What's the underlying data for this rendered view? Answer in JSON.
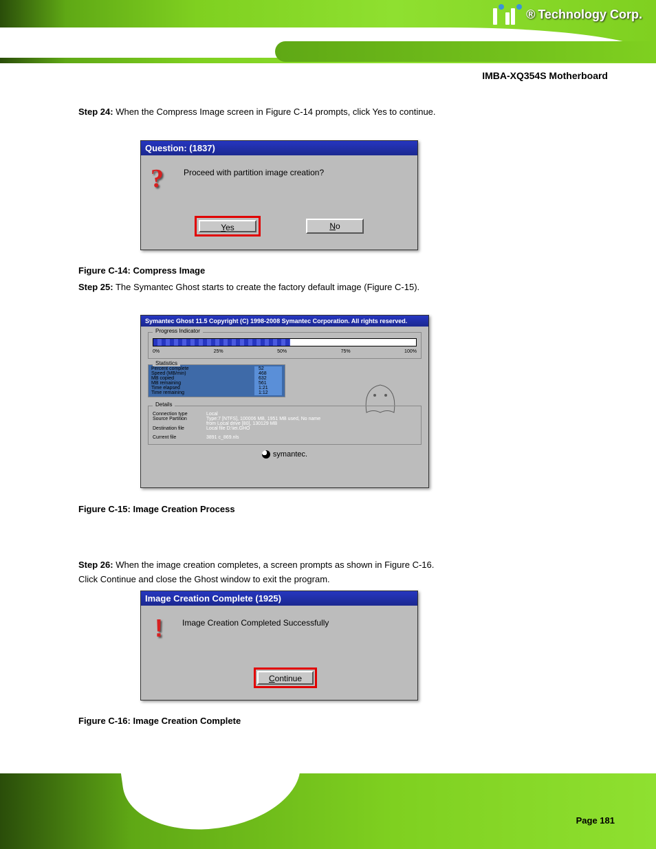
{
  "header": {
    "brand_prefix": "®",
    "brand": "Technology Corp."
  },
  "model_line": "IMBA-XQ354S Motherboard",
  "step24": {
    "num": "Step 24:",
    "text": " When the Compress Image screen in Figure C-14 prompts, click Yes to continue."
  },
  "caption14": "Figure C-14: Compress Image",
  "step25": {
    "num": "Step 25:",
    "text": " The Symantec Ghost starts to create the factory default image (Figure C-15)."
  },
  "caption15": "Figure C-15: Image Creation Process",
  "step26": {
    "num": "Step 26:",
    "text_a": " When the image creation completes, a screen prompts as shown in Figure C-16.",
    "text_b": "Click Continue and close the Ghost window to exit the program."
  },
  "caption16": "Figure C-16: Image Creation Complete",
  "page": "Page 181",
  "dlg1": {
    "title": "Question: (1837)",
    "message": "Proceed with partition image creation?",
    "yes": "Yes",
    "no": "No"
  },
  "ghost": {
    "title": "Symantec Ghost 11.5   Copyright (C) 1998-2008 Symantec Corporation. All rights reserved.",
    "progress_legend": "Progress Indicator",
    "ticks": [
      "0%",
      "25%",
      "50%",
      "75%",
      "100%"
    ],
    "stats_legend": "Statistics",
    "stats": {
      "percent_complete_lbl": "Percent complete",
      "percent_complete": "52",
      "speed_lbl": "Speed (MB/min)",
      "speed": "468",
      "mb_copied_lbl": "MB copied",
      "mb_copied": "632",
      "mb_remaining_lbl": "MB remaining",
      "mb_remaining": "561",
      "time_elapsed_lbl": "Time elapsed",
      "time_elapsed": "1:21",
      "time_remaining_lbl": "Time remaining",
      "time_remaining": "1:12"
    },
    "details_legend": "Details",
    "details": {
      "conn_type_lbl": "Connection type",
      "conn_type": "Local",
      "src_part_lbl": "Source Partition",
      "src_part": "Type:7 [NTFS], 100006 MB, 1951 MB used, No name",
      "src_part2": "from Local drive [80], 130129 MB",
      "dest_lbl": "Destination file",
      "dest": "Local file D:\\iei.GHO",
      "cur_lbl": "Current file",
      "cur": "3891 c_869.nls"
    },
    "brand": "symantec."
  },
  "dlg3": {
    "title": "Image Creation Complete (1925)",
    "message": "Image Creation Completed Successfully",
    "continue": "Continue"
  },
  "chart_data": {
    "type": "bar",
    "title": "Ghost image creation progress",
    "categories": [
      "Percent complete",
      "Speed (MB/min)",
      "MB copied",
      "MB remaining",
      "Time elapsed (s)",
      "Time remaining (s)"
    ],
    "values": [
      52,
      468,
      632,
      561,
      81,
      72
    ],
    "progress_percent": 52
  }
}
